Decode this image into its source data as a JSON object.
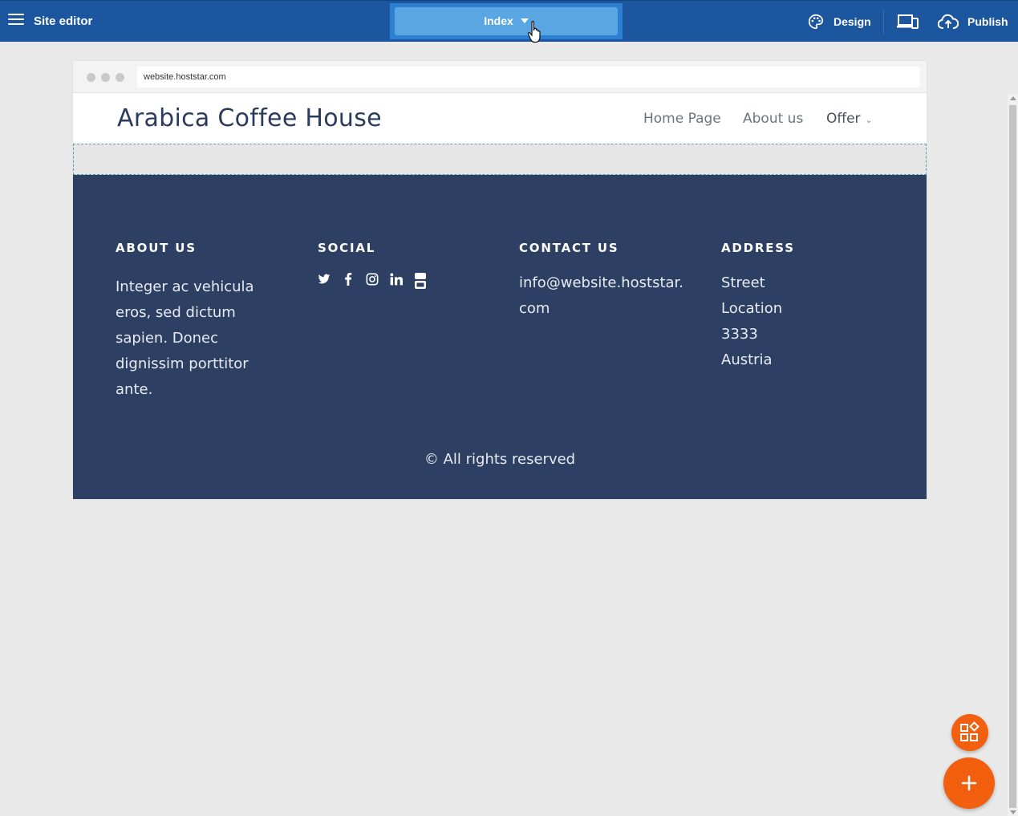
{
  "topbar": {
    "title": "Site editor",
    "page_selector": "Index",
    "design_label": "Design",
    "publish_label": "Publish"
  },
  "browser": {
    "url": "website.hoststar.com"
  },
  "site": {
    "brand": "Arabica Coffee House",
    "nav": {
      "home": "Home Page",
      "about": "About us",
      "offer": "Offer"
    }
  },
  "footer": {
    "about": {
      "heading": "ABOUT US",
      "text": "Integer ac vehicula eros, sed dictum sapien. Donec dignissim porttitor ante."
    },
    "social": {
      "heading": "SOCIAL",
      "icons": [
        "twitter-icon",
        "facebook-icon",
        "instagram-icon",
        "linkedin-icon",
        "youtube-icon"
      ]
    },
    "contact": {
      "heading": "CONTACT US",
      "email": "info@website.hoststar.com"
    },
    "address": {
      "heading": "ADDRESS",
      "lines": [
        "Street",
        "Location",
        "3333",
        "Austria"
      ]
    },
    "copyright": "© All rights reserved"
  },
  "colors": {
    "topbar": "#1b569f",
    "page_selector": "#5aa6e3",
    "footer_bg": "#2d3f62",
    "fab": "#f25f0f"
  }
}
